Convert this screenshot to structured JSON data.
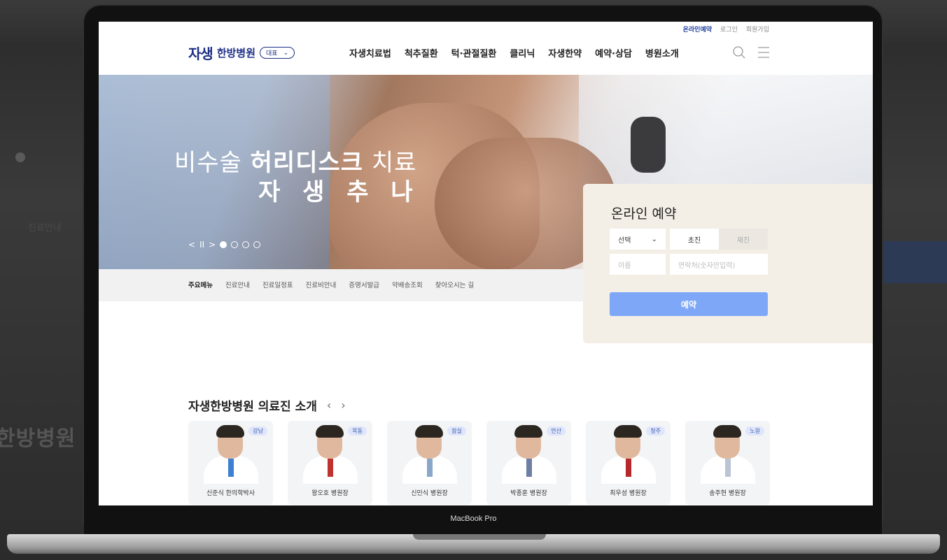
{
  "background": {
    "left_text": "한방병원",
    "left_menu": "진료안내"
  },
  "device_label": "MacBook Pro",
  "header": {
    "util_links": [
      "온라인예약",
      "로그인",
      "회원가입"
    ],
    "logo_main": "자생",
    "logo_sub": "한방병원",
    "branch_select": "대표",
    "nav": [
      "자생치료법",
      "척추질환",
      "턱·관절질환",
      "클리닉",
      "자생한약",
      "예약·상담",
      "병원소개"
    ]
  },
  "hero": {
    "line1_light": "비수술 ",
    "line1_bold": "허리디스크",
    "line1_tail": " 치료",
    "line2": "자 생 추 나",
    "slider": {
      "prev": "<",
      "pause": "II",
      "next": ">",
      "total": 4,
      "active": 1
    }
  },
  "quick_menu": {
    "label": "주요메뉴",
    "items": [
      "진료안내",
      "진료일정표",
      "진료비안내",
      "증명서발급",
      "약배송조회",
      "찾아오시는 길"
    ]
  },
  "booking": {
    "title": "온라인 예약",
    "select_label": "선택",
    "visit_types": [
      "초진",
      "재진"
    ],
    "name_placeholder": "이름",
    "phone_placeholder": "연락처(숫자만입력)",
    "submit": "예약"
  },
  "doctors": {
    "title": "자생한방병원 의료진 소개",
    "list": [
      {
        "branch": "강남",
        "name": "신준식 한의학박사",
        "tie": "#3d7fd1"
      },
      {
        "branch": "목동",
        "name": "왕오호 병원장",
        "tie": "#c0322f"
      },
      {
        "branch": "잠실",
        "name": "신민식 병원장",
        "tie": "#8aa7c9"
      },
      {
        "branch": "안산",
        "name": "박종훈 병원장",
        "tie": "#6d7fa3"
      },
      {
        "branch": "청주",
        "name": "최우성 병원장",
        "tie": "#b7282c"
      },
      {
        "branch": "노원",
        "name": "송주현 병원장",
        "tie": "#b9c4d4"
      }
    ]
  },
  "colors": {
    "brand": "#1d2f86",
    "booking_button": "#7ea7f7",
    "booking_bg": "#f4efe6"
  }
}
